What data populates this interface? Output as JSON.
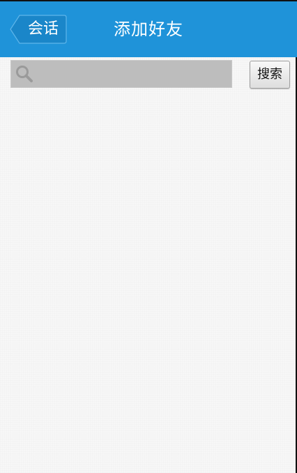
{
  "header": {
    "back_label": "会话",
    "title": "添加好友"
  },
  "search": {
    "value": "",
    "placeholder": "",
    "button_label": "搜索"
  },
  "icons": {
    "back": "back-arrow-icon",
    "search": "search-icon"
  },
  "colors": {
    "header_bg": "#1f93d9",
    "search_bar_bg": "#bdbdbd",
    "page_bg": "#f7f7f7"
  }
}
